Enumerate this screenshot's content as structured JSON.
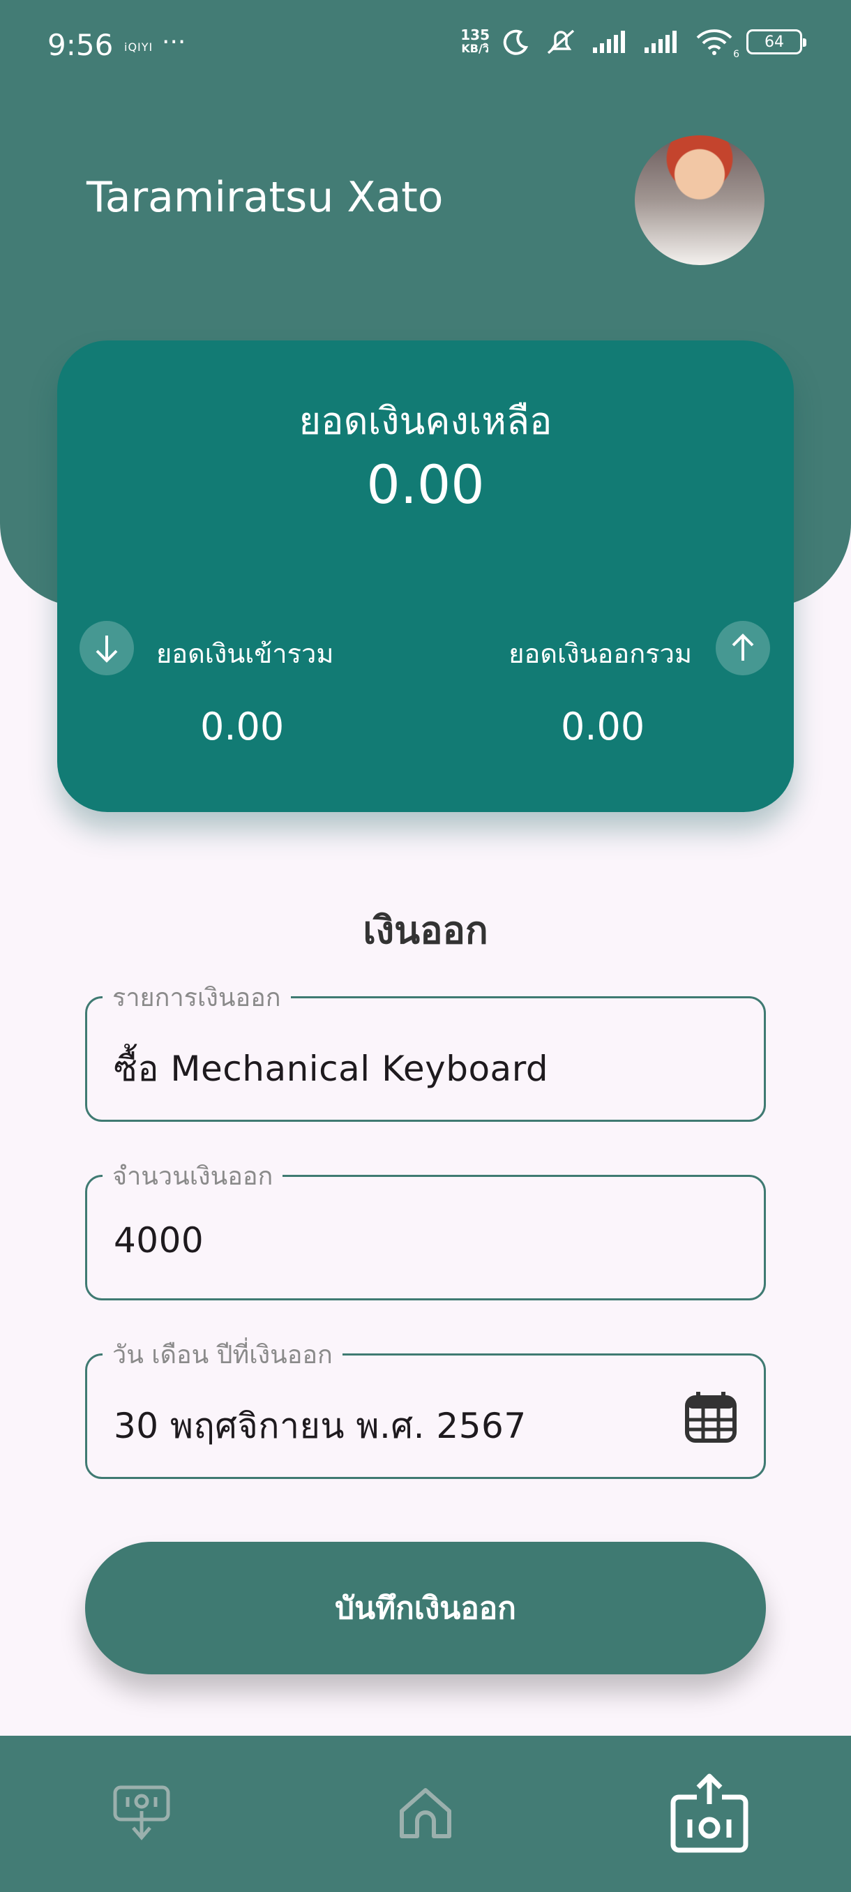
{
  "status_bar": {
    "time": "9:56",
    "app_badge": "iQIYI",
    "more": "···",
    "speed_value": "135",
    "speed_unit": "KB/วิ",
    "wifi_label": "6",
    "battery": "64"
  },
  "header": {
    "user_name": "Taramiratsu Xato"
  },
  "balance_card": {
    "title": "ยอดเงินคงเหลือ",
    "balance": "0.00",
    "income_label": "ยอดเงินเข้ารวม",
    "income_total": "0.00",
    "expense_label": "ยอดเงินออกรวม",
    "expense_total": "0.00"
  },
  "form": {
    "title": "เงินออก",
    "description": {
      "label": "รายการเงินออก",
      "value": "ซื้อ Mechanical Keyboard"
    },
    "amount": {
      "label": "จำนวนเงินออก",
      "value": "4000"
    },
    "date": {
      "label": "วัน เดือน ปีที่เงินออก",
      "value": "30 พฤศจิกายน พ.ศ. 2567"
    },
    "save_label": "บันทึกเงินออก"
  },
  "bottom_nav": {
    "items": [
      {
        "icon": "income-icon",
        "active": false
      },
      {
        "icon": "home-icon",
        "active": false
      },
      {
        "icon": "expense-icon",
        "active": true
      }
    ]
  },
  "colors": {
    "header": "#437c75",
    "card": "#127b74",
    "accent": "#3f7a72",
    "background": "#fbf5fb"
  }
}
